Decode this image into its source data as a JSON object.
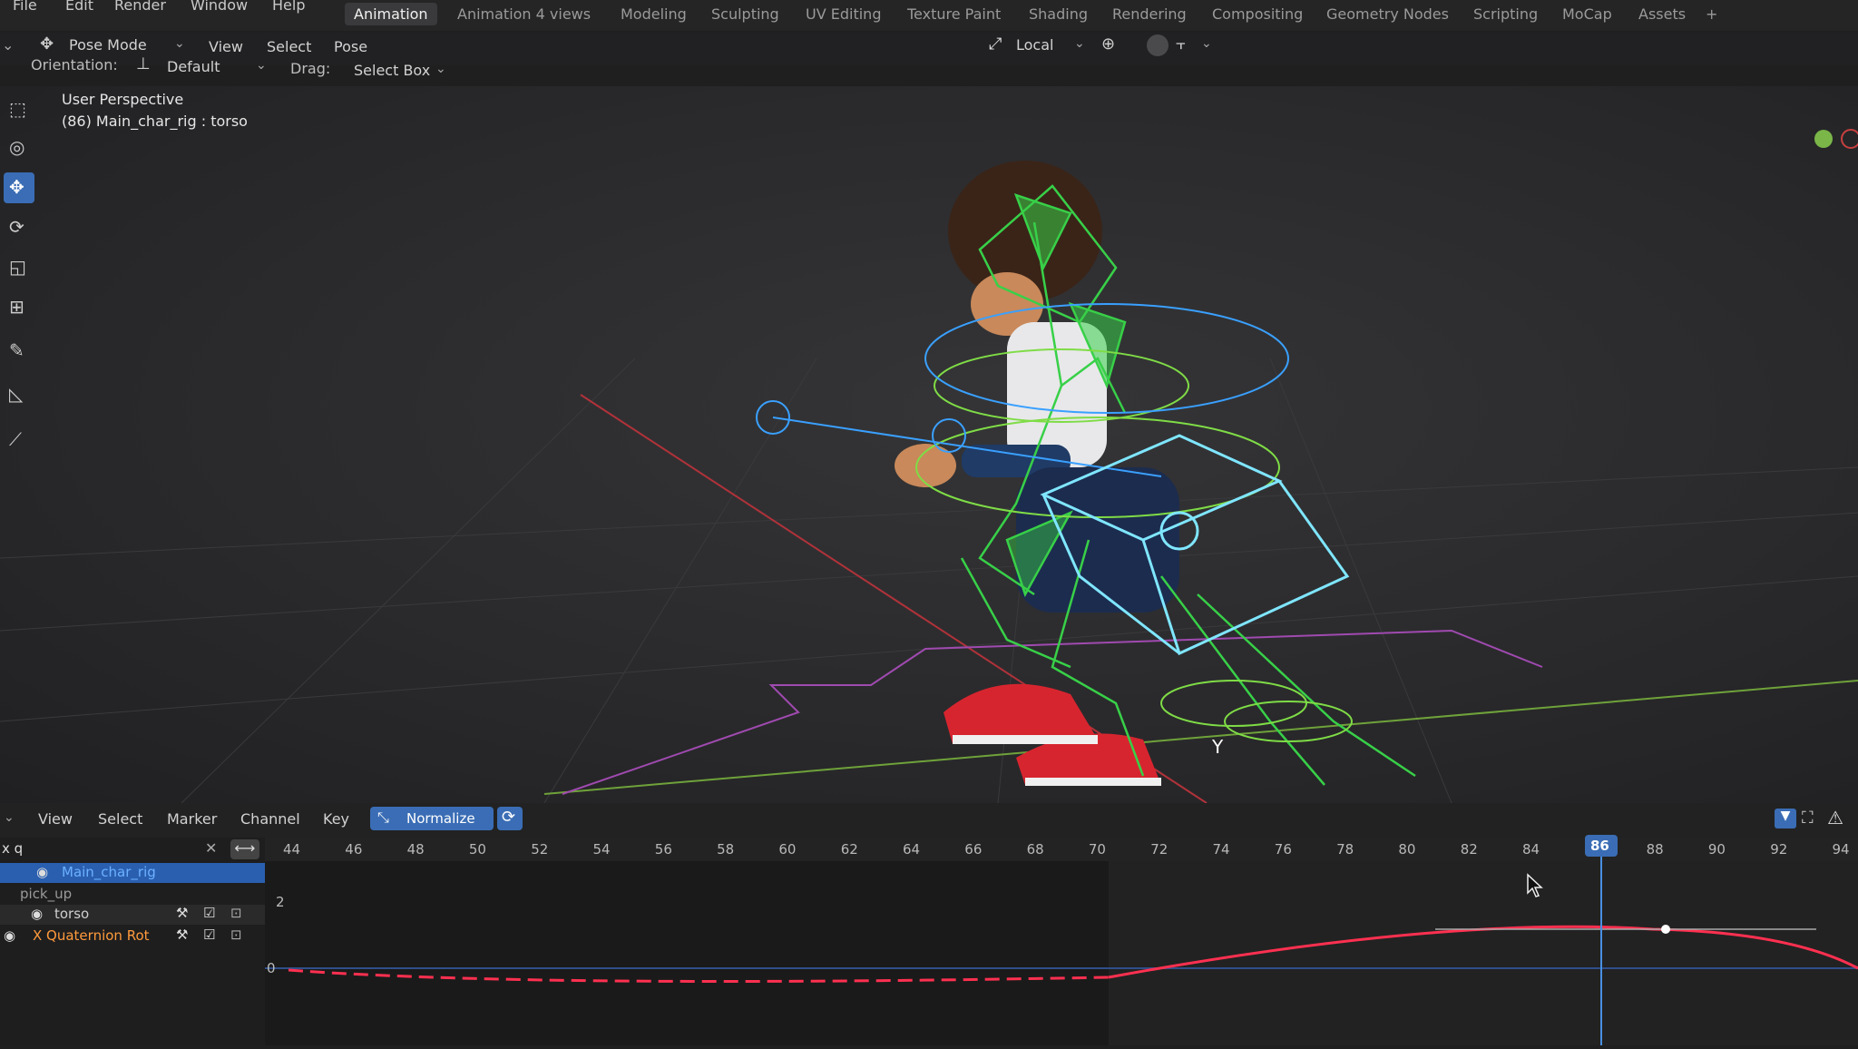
{
  "topbar": {
    "menus": [
      "File",
      "Edit",
      "Render",
      "Window",
      "Help"
    ],
    "workspaces": [
      "Animation",
      "Animation 4 views",
      "Modeling",
      "Sculpting",
      "UV Editing",
      "Texture Paint",
      "Shading",
      "Rendering",
      "Compositing",
      "Geometry Nodes",
      "Scripting",
      "MoCap",
      "Assets"
    ],
    "active_workspace": "Animation",
    "add_tab": "+"
  },
  "header": {
    "mode": "Pose Mode",
    "menus": [
      "View",
      "Select",
      "Pose"
    ],
    "transform_space": "Local",
    "orientation_label": "Orientation:",
    "orientation_value": "Default",
    "drag_label": "Drag:",
    "drag_value": "Select Box"
  },
  "viewport": {
    "view_name": "User Perspective",
    "active_info": "(86) Main_char_rig : torso",
    "axis_label": "Y"
  },
  "timeline": {
    "menus": [
      "View",
      "Select",
      "Marker",
      "Channel",
      "Key"
    ],
    "normalize_label": "Normalize",
    "search_value": "x q",
    "frames": [
      44,
      46,
      48,
      50,
      52,
      54,
      56,
      58,
      60,
      62,
      64,
      66,
      68,
      70,
      72,
      74,
      76,
      78,
      80,
      82,
      84,
      86,
      88,
      90,
      92,
      94
    ],
    "current_frame": 86,
    "y_label_top": "2",
    "y_label_zero": "0",
    "channels": [
      {
        "label": "Main_char_rig",
        "color": "#6cb0ff",
        "selected": true
      },
      {
        "label": "pick_up",
        "color": "#9a9a9a",
        "selected": false
      },
      {
        "label": "torso",
        "color": "#cfcfcf",
        "selected": false
      },
      {
        "label": "X Quaternion Rot",
        "color": "#ff9a3c",
        "selected": false
      }
    ]
  },
  "colors": {
    "accent": "#3a6db5",
    "curve": "#ff3050",
    "playhead": "#4a90e2",
    "bones": "#38d048",
    "gizmo": "#7fe6ff"
  }
}
